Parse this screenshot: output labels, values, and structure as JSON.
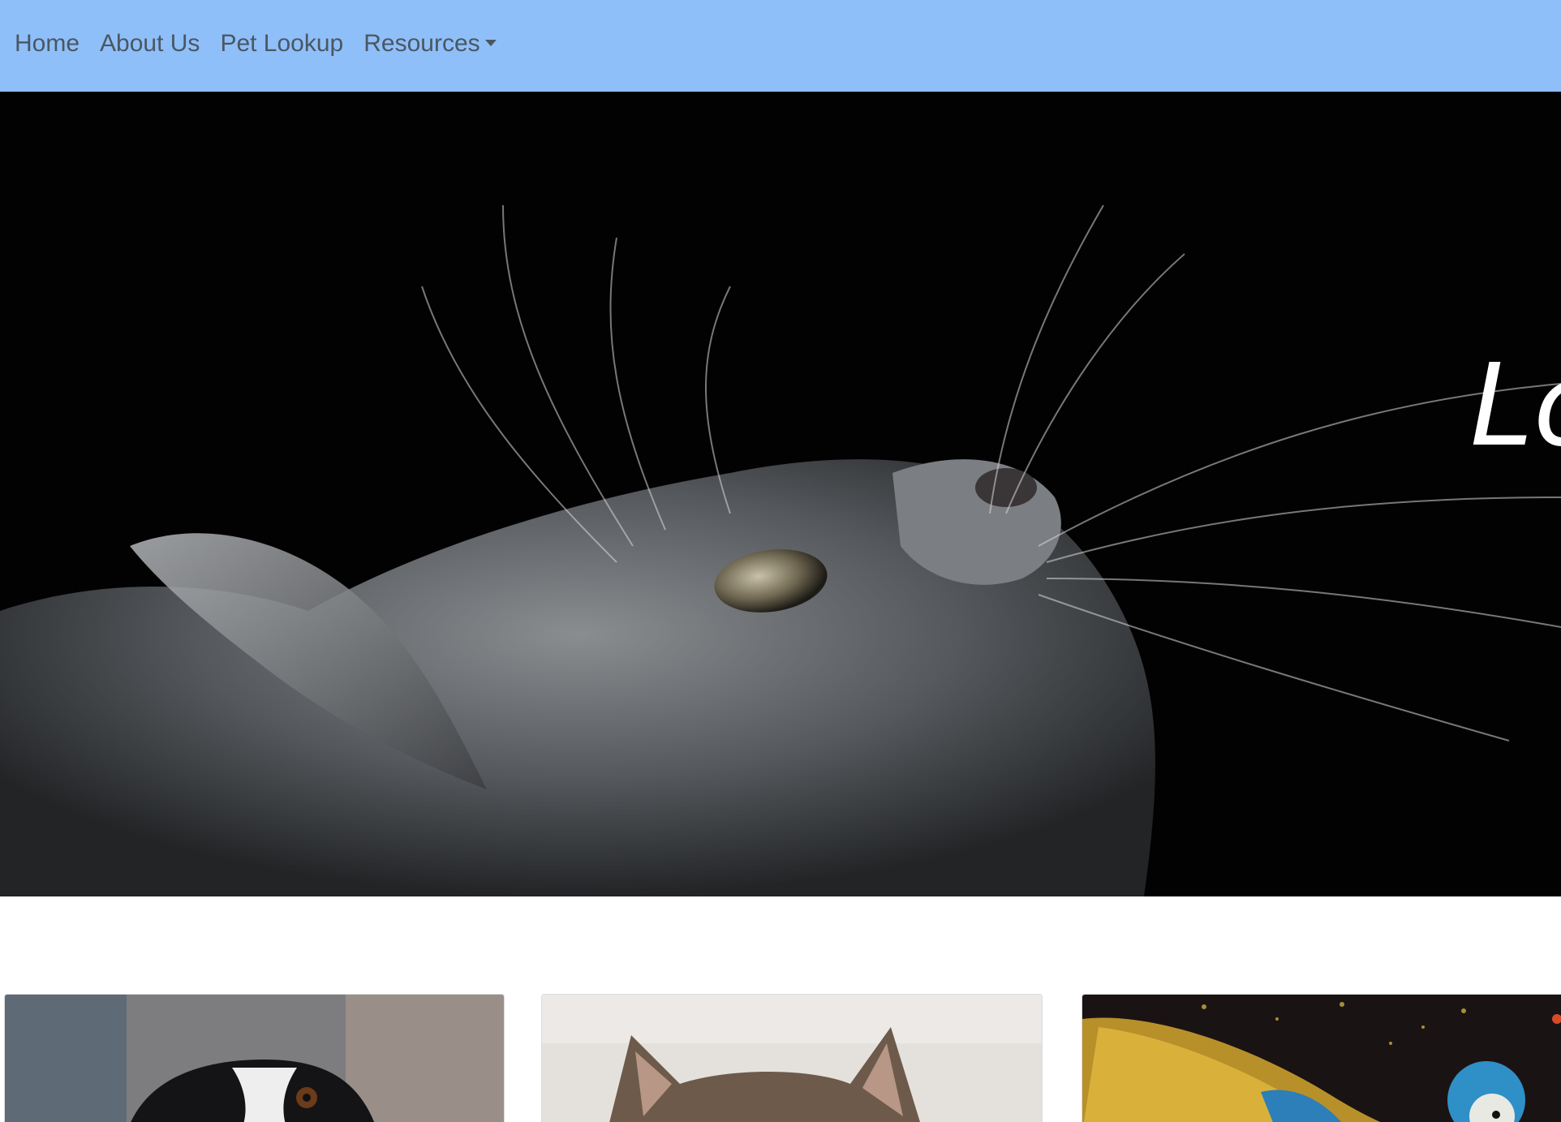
{
  "navbar": {
    "background": "#8fbff9",
    "items": [
      {
        "label": "Home"
      },
      {
        "label": "About Us"
      },
      {
        "label": "Pet Lookup"
      },
      {
        "label": "Resources",
        "dropdown": true
      }
    ]
  },
  "hero": {
    "image": "gray kitten looking up on black background",
    "overlay_text": "Lo"
  },
  "cards": [
    {
      "image": "black and white dog"
    },
    {
      "image": "tabby cat from behind"
    },
    {
      "image": "blue and gold macaw parrot"
    }
  ]
}
